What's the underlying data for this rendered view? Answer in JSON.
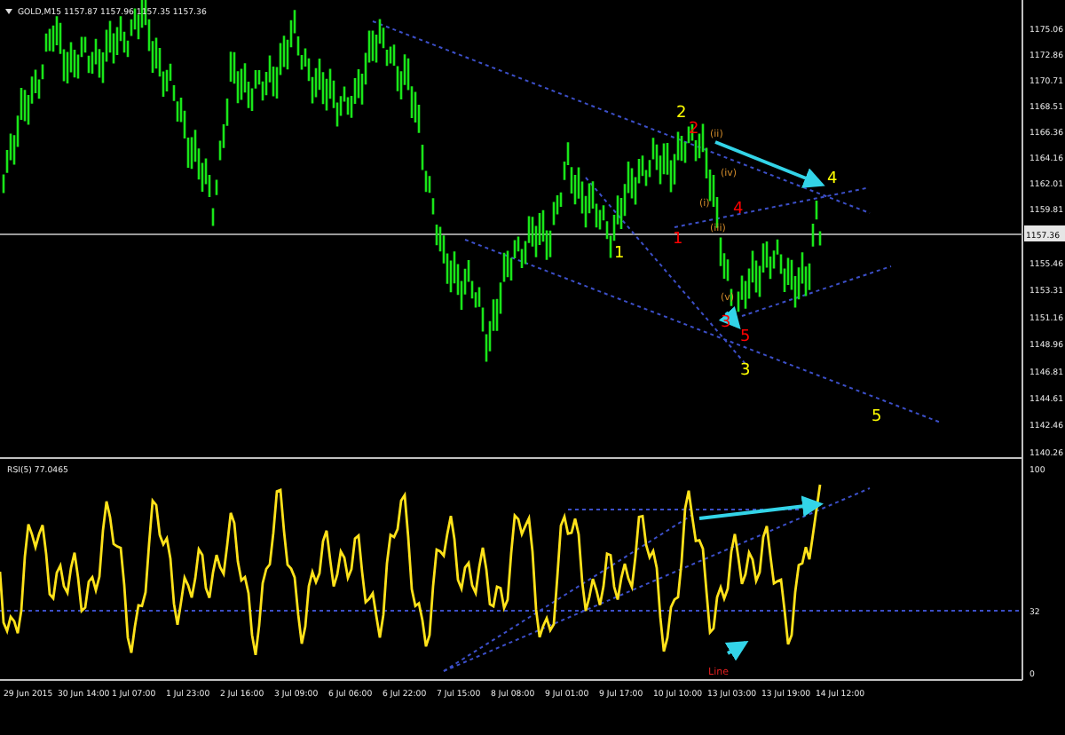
{
  "chart_header": "GOLD,M15 1157.87 1157.96 1157.35 1157.36",
  "price_axis": {
    "labels": [
      "1175.06",
      "1172.86",
      "1170.71",
      "1168.51",
      "1166.36",
      "1164.16",
      "1162.01",
      "1159.81",
      "1155.46",
      "1153.31",
      "1151.16",
      "1148.96",
      "1146.81",
      "1144.61",
      "1142.46",
      "1140.26"
    ],
    "current_price": "1157.36"
  },
  "wave_labels": [
    {
      "text": "2",
      "color": "#ffff00"
    },
    {
      "text": "1",
      "color": "#ffff00"
    },
    {
      "text": "3",
      "color": "#ffff00"
    },
    {
      "text": "4",
      "color": "#ffff00"
    },
    {
      "text": "5",
      "color": "#ffff00"
    },
    {
      "text": "2",
      "color": "#ff0000"
    },
    {
      "text": "1",
      "color": "#ff0000"
    },
    {
      "text": "4",
      "color": "#ff0000"
    },
    {
      "text": "3",
      "color": "#ff0000"
    },
    {
      "text": "5",
      "color": "#ff0000"
    },
    {
      "text": "(ii)",
      "color": "#d08a2a"
    },
    {
      "text": "(iv)",
      "color": "#d08a2a"
    },
    {
      "text": "(i)",
      "color": "#d08a2a"
    },
    {
      "text": "(iii)",
      "color": "#d08a2a"
    },
    {
      "text": "(v)",
      "color": "#d08a2a"
    }
  ],
  "indicator": {
    "header": "RSI(5) 77.0465",
    "axis_labels": [
      "100",
      "32",
      "0"
    ],
    "note": "Line"
  },
  "time_axis": [
    "29 Jun 2015",
    "30 Jun 14:00",
    "1 Jul 07:00",
    "1 Jul 23:00",
    "2 Jul 16:00",
    "3 Jul 09:00",
    "6 Jul 06:00",
    "6 Jul 22:00",
    "7 Jul 15:00",
    "8 Jul 08:00",
    "9 Jul 01:00",
    "9 Jul 17:00",
    "10 Jul 10:00",
    "13 Jul 03:00",
    "13 Jul 19:00",
    "14 Jul 12:00"
  ]
}
